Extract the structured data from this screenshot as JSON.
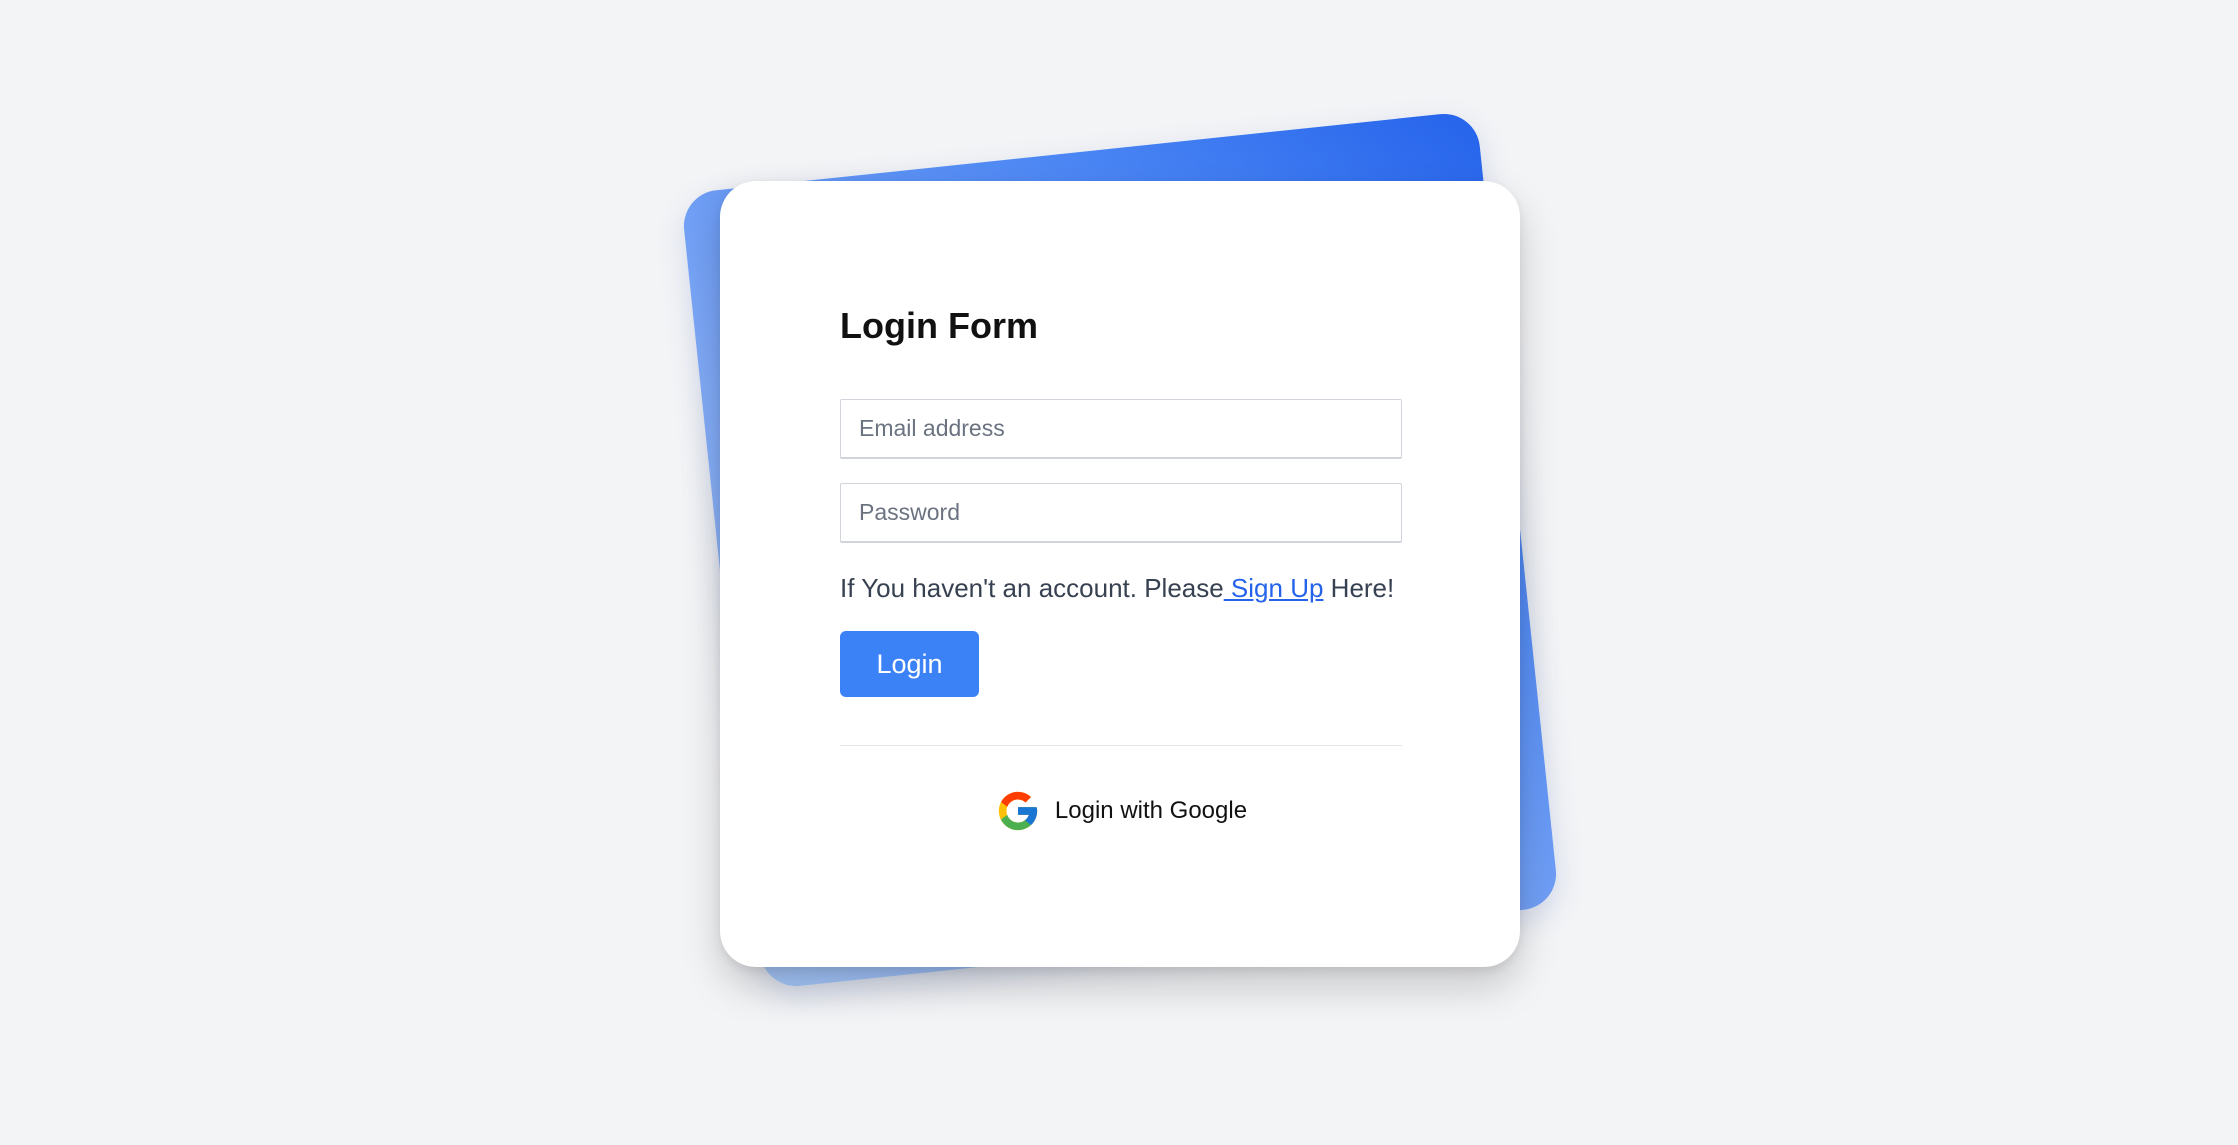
{
  "form": {
    "title": "Login Form",
    "email_placeholder": "Email address",
    "email_value": "",
    "password_placeholder": "Password",
    "password_value": "",
    "signup_prefix": "If You haven't an account. Please",
    "signup_link": " Sign Up",
    "signup_suffix": " Here!",
    "login_label": "Login",
    "google_label": "Login with Google",
    "google_icon": "google-icon"
  },
  "colors": {
    "background": "#f3f4f6",
    "accent": "#3b82f6",
    "link": "#2563eb",
    "back_card_gradient_start": "#a8c9fb",
    "back_card_gradient_end": "#2563eb"
  }
}
